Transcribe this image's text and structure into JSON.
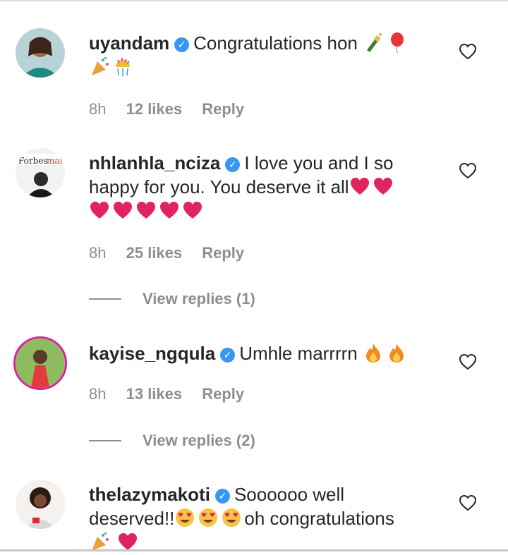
{
  "comments": [
    {
      "username": "uyandam",
      "text": "Congratulations hon",
      "emoji_inline": [
        "champagne-emoji",
        "balloon-emoji"
      ],
      "emoji_line2": [
        "party-popper-emoji",
        "confetti-ball-emoji"
      ],
      "time": "8h",
      "likes": "12 likes",
      "reply": "Reply"
    },
    {
      "username": "nhlanhla_nciza",
      "text_line1": "I love you and I so",
      "text_line2": "happy for you. You deserve it all",
      "hearts_line2": 2,
      "hearts_line3": 5,
      "time": "8h",
      "likes": "25 likes",
      "reply": "Reply",
      "view_replies": "View replies (1)"
    },
    {
      "username": "kayise_ngqula",
      "text": "Umhle marrrrn",
      "fire_count": 2,
      "time": "8h",
      "likes": "13 likes",
      "reply": "Reply",
      "view_replies": "View replies (2)"
    },
    {
      "username": "thelazymakoti",
      "text_line1": "Soooooo well",
      "text_line2a": "deserved!!",
      "text_line2b": "oh congratulations",
      "heart_eyes_count": 3
    }
  ],
  "colors": {
    "verified_badge": "#3897f0",
    "meta_text": "#8e8e8e",
    "heart_emoji": "#e0245e",
    "story_ring": "#d6249f"
  }
}
